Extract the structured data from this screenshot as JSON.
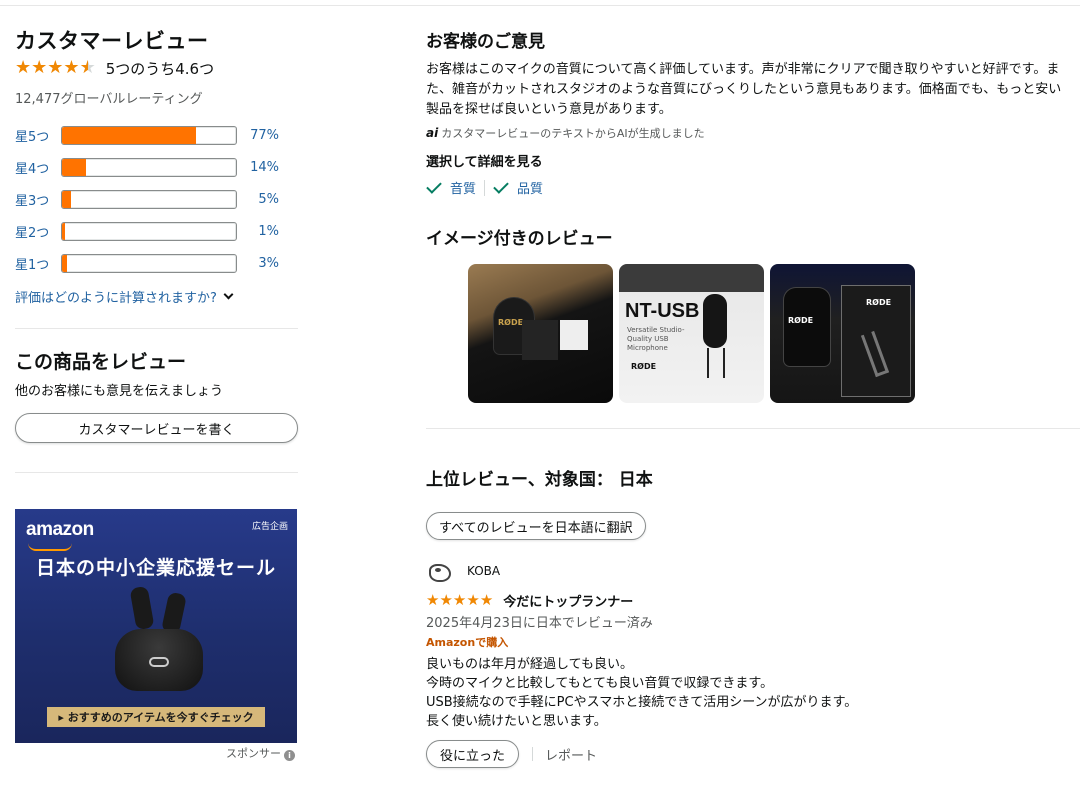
{
  "left": {
    "heading": "カスタマーレビュー",
    "avg_text": "5つのうち4.6つ",
    "avg_rating": 4.6,
    "global_count": "12,477グローバルレーティング",
    "histogram": [
      {
        "label": "星5つ",
        "pct": "77%",
        "value": 77
      },
      {
        "label": "星4つ",
        "pct": "14%",
        "value": 14
      },
      {
        "label": "星3つ",
        "pct": "5%",
        "value": 5
      },
      {
        "label": "星2つ",
        "pct": "1%",
        "value": 1
      },
      {
        "label": "星1つ",
        "pct": "3%",
        "value": 3
      }
    ],
    "how_link": "評価はどのように計算されますか?",
    "write_heading": "この商品をレビュー",
    "write_sub": "他のお客様にも意見を伝えましょう",
    "write_button": "カスタマーレビューを書く"
  },
  "ad": {
    "logo": "amazon",
    "tag": "広告企画",
    "title": "日本の中小企業応援セール",
    "cta": "▸ おすすめのアイテムを今すぐチェック",
    "sponsor": "スポンサー",
    "info_icon": "i"
  },
  "opinions": {
    "heading": "お客様のご意見",
    "summary": "お客様はこのマイクの音質について高く評価しています。声が非常にクリアで聞き取りやすいと好評です。また、雑音がカットされスタジオのような音質にびっくりしたという意見もあります。価格面でも、もっと安い製品を探せば良いという意見があります。",
    "ai_icon": "ai",
    "ai_note": "カスタマーレビューのテキストからAIが生成しました",
    "select_label": "選択して詳細を見る",
    "aspects": [
      "音質",
      "品質"
    ]
  },
  "images": {
    "heading": "イメージ付きのレビュー",
    "thumb1_brand": "RØDE",
    "thumb2_title": "NT-USB",
    "thumb2_sub": "Versatile Studio-Quality USB Microphone",
    "thumb2_brand": "RØDE",
    "thumb3_brand": "RØDE",
    "thumb3_brand2": "RØDE"
  },
  "top_reviews": {
    "heading": "上位レビュー、対象国： 日本",
    "translate_button": "すべてのレビューを日本語に翻訳",
    "review": {
      "name": "KOBA",
      "rating": 5,
      "title": "今だにトップランナー",
      "date": "2025年4月23日に日本でレビュー済み",
      "badge": "Amazonで購入",
      "body": [
        "良いものは年月が経過しても良い。",
        "今時のマイクと比較してもとても良い音質で収録できます。",
        "USB接続なので手軽にPCやスマホと接続できて活用シーンが広がります。",
        "長く使い続けたいと思います。"
      ],
      "helpful": "役に立った",
      "report": "レポート"
    }
  },
  "colors": {
    "bar_fill": "#ff7300",
    "star": "#f08804",
    "link": "#2162a1",
    "check": "#067d62",
    "badge": "#c45500"
  }
}
